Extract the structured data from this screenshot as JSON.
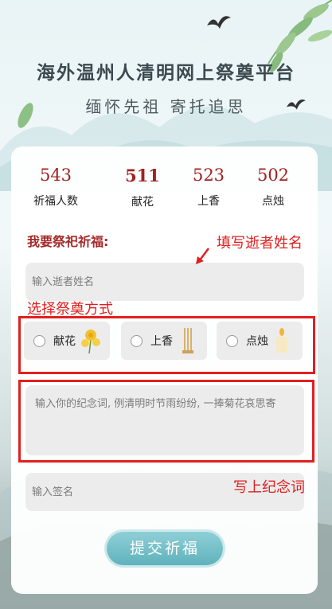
{
  "header": {
    "title": "海外温州人清明网上祭奠平台",
    "subtitle": "缅怀先祖 寄托追思"
  },
  "stats": [
    {
      "value": "543",
      "label": "祈福人数"
    },
    {
      "value": "511",
      "label": "献花"
    },
    {
      "value": "523",
      "label": "上香"
    },
    {
      "value": "502",
      "label": "点烛"
    }
  ],
  "form": {
    "section_title": "我要祭祀祈福:",
    "name_placeholder": "输入逝者姓名",
    "options": [
      {
        "label": "献花",
        "icon": "chrysanthemum-icon"
      },
      {
        "label": "上香",
        "icon": "incense-icon"
      },
      {
        "label": "点烛",
        "icon": "candle-icon"
      }
    ],
    "message_placeholder": "输入你的纪念词, 例清明时节雨纷纷, 一捧菊花哀思寄",
    "signature_placeholder": "输入签名",
    "submit_label": "提交祈福"
  },
  "annotations": {
    "fill_name": "填写逝者姓名",
    "choose_method": "选择祭奠方式",
    "write_message": "写上纪念词"
  },
  "colors": {
    "stat_number": "#a02222",
    "section_title": "#a52a2a",
    "annotation": "#e02020",
    "button": "#6ab9c2"
  }
}
